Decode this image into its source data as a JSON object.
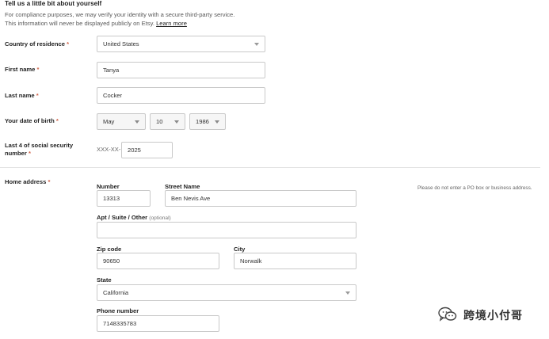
{
  "header": {
    "title": "Tell us a little bit about yourself",
    "intro_line1": "For compliance purposes, we may verify your identity with a secure third-party service.",
    "intro_line2": "This information will never be displayed publicly on Etsy.",
    "learn_more": "Learn more"
  },
  "required_mark": "*",
  "country": {
    "label": "Country of residence",
    "value": "United States"
  },
  "first_name": {
    "label": "First name",
    "value": "Tanya"
  },
  "last_name": {
    "label": "Last name",
    "value": "Cocker"
  },
  "dob": {
    "label": "Your date of birth",
    "month": "May",
    "day": "10",
    "year": "1986"
  },
  "ssn": {
    "label_line1": "Last 4 of social security",
    "label_line2": "number",
    "prefix": "XXX-XX-",
    "value": "2025"
  },
  "address": {
    "label": "Home address",
    "hint": "Please do not enter a PO box or business address.",
    "number": {
      "label": "Number",
      "value": "13313"
    },
    "street": {
      "label": "Street Name",
      "value": "Ben Nevis Ave"
    },
    "apt": {
      "label": "Apt / Suite / Other",
      "optional": "(optional)",
      "value": ""
    },
    "zip": {
      "label": "Zip code",
      "value": "90650"
    },
    "city": {
      "label": "City",
      "value": "Norwalk"
    },
    "state": {
      "label": "State",
      "value": "California"
    },
    "phone": {
      "label": "Phone number",
      "value": "7148335783"
    }
  },
  "watermark": {
    "text": "跨境小付哥"
  }
}
